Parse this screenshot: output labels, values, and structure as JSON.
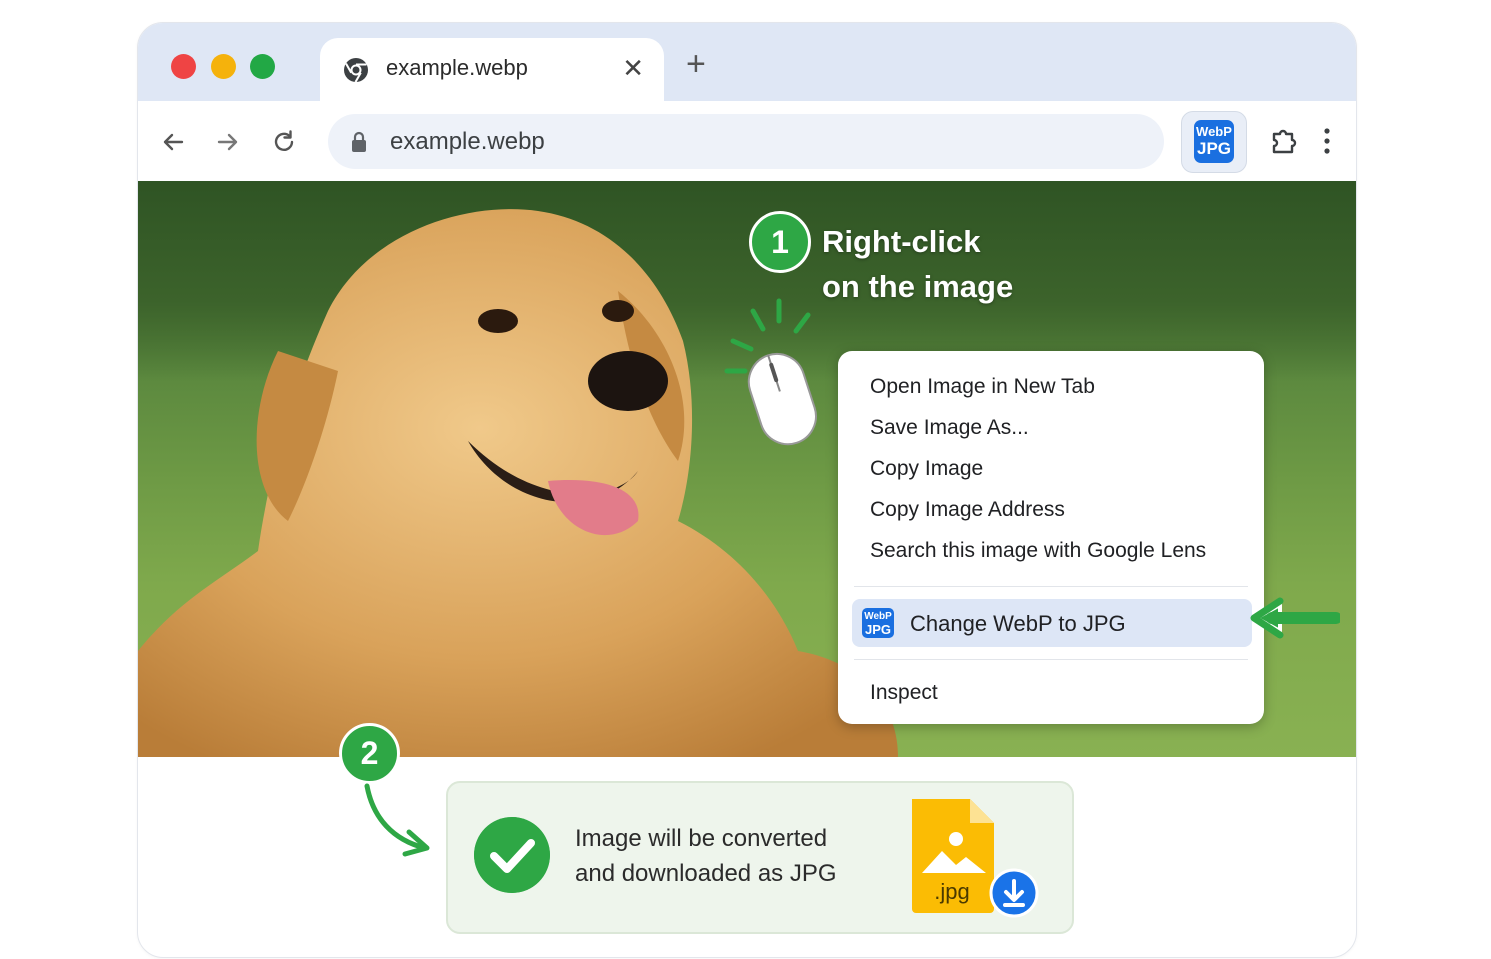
{
  "tab": {
    "title": "example.webp",
    "close": "✕"
  },
  "newtab_label": "+",
  "address": {
    "url": "example.webp"
  },
  "extension": {
    "line1": "WebP",
    "line2": "JPG"
  },
  "step1": {
    "number": "1",
    "line1": "Right-click",
    "line2": "on the image"
  },
  "context_menu": {
    "items": [
      "Open Image in New Tab",
      "Save Image As...",
      "Copy Image",
      "Copy Image Address",
      "Search this image with Google Lens"
    ],
    "highlighted": {
      "label": "Change WebP to JPG",
      "icon_line1": "WebP",
      "icon_line2": "JPG"
    },
    "last": "Inspect"
  },
  "step2": {
    "number": "2"
  },
  "notice": {
    "line1": "Image will be converted",
    "line2": "and downloaded as JPG",
    "file_ext": ".jpg"
  },
  "colors": {
    "green": "#2ea745",
    "blue": "#1a6fe0",
    "tabstrip": "#dfe7f5",
    "highlight": "#dde6f6"
  }
}
